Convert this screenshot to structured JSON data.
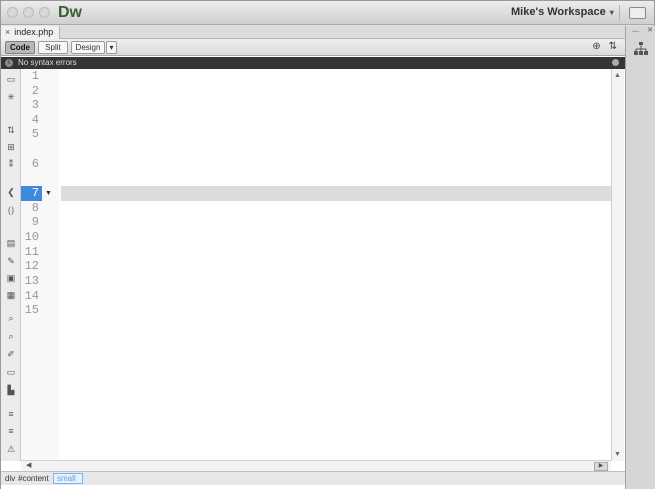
{
  "app": {
    "logo": "Dw",
    "workspace": "Mike's Workspace"
  },
  "tab": {
    "close": "×",
    "name": "index.php"
  },
  "toolbar": {
    "views": [
      "Code",
      "Split",
      "Design"
    ],
    "dropdown_arrow": "▾",
    "active_view": "Code",
    "right_icons": [
      "inspect-icon",
      "sort-icon"
    ]
  },
  "status": {
    "icon": "i",
    "text": "No syntax errors"
  },
  "editor": {
    "line_numbers": [
      "1",
      "2",
      "3",
      "4",
      "5",
      "",
      "6",
      "",
      "7",
      "8",
      "9",
      "10",
      "11",
      "12",
      "13",
      "14",
      "15"
    ],
    "current_line": "7",
    "fold_marker": "▼"
  },
  "tagbar": {
    "tags": [
      "div",
      "#content",
      "small"
    ]
  },
  "colors": {
    "php_delim": "#e2302a",
    "tag": "#1f1fa8",
    "comment": "#f07818",
    "html_comment": "#b7b7b7",
    "current_line": "#3f8ae0",
    "logo": "#37622f"
  }
}
